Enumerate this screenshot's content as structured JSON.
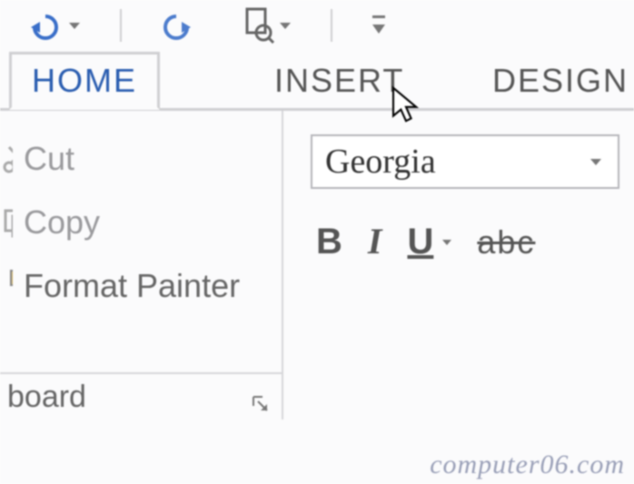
{
  "qat": {
    "undo": "undo",
    "redo": "redo",
    "preview": "print-preview"
  },
  "tabs": {
    "home": "HOME",
    "insert": "INSERT",
    "design": "DESIGN"
  },
  "clipboard": {
    "cut": "Cut",
    "copy": "Copy",
    "format_painter": "Format Painter",
    "group_label": "board"
  },
  "font": {
    "name": "Georgia",
    "bold": "B",
    "italic": "I",
    "underline": "U",
    "strike": "abc"
  },
  "watermark": "computer06.com"
}
